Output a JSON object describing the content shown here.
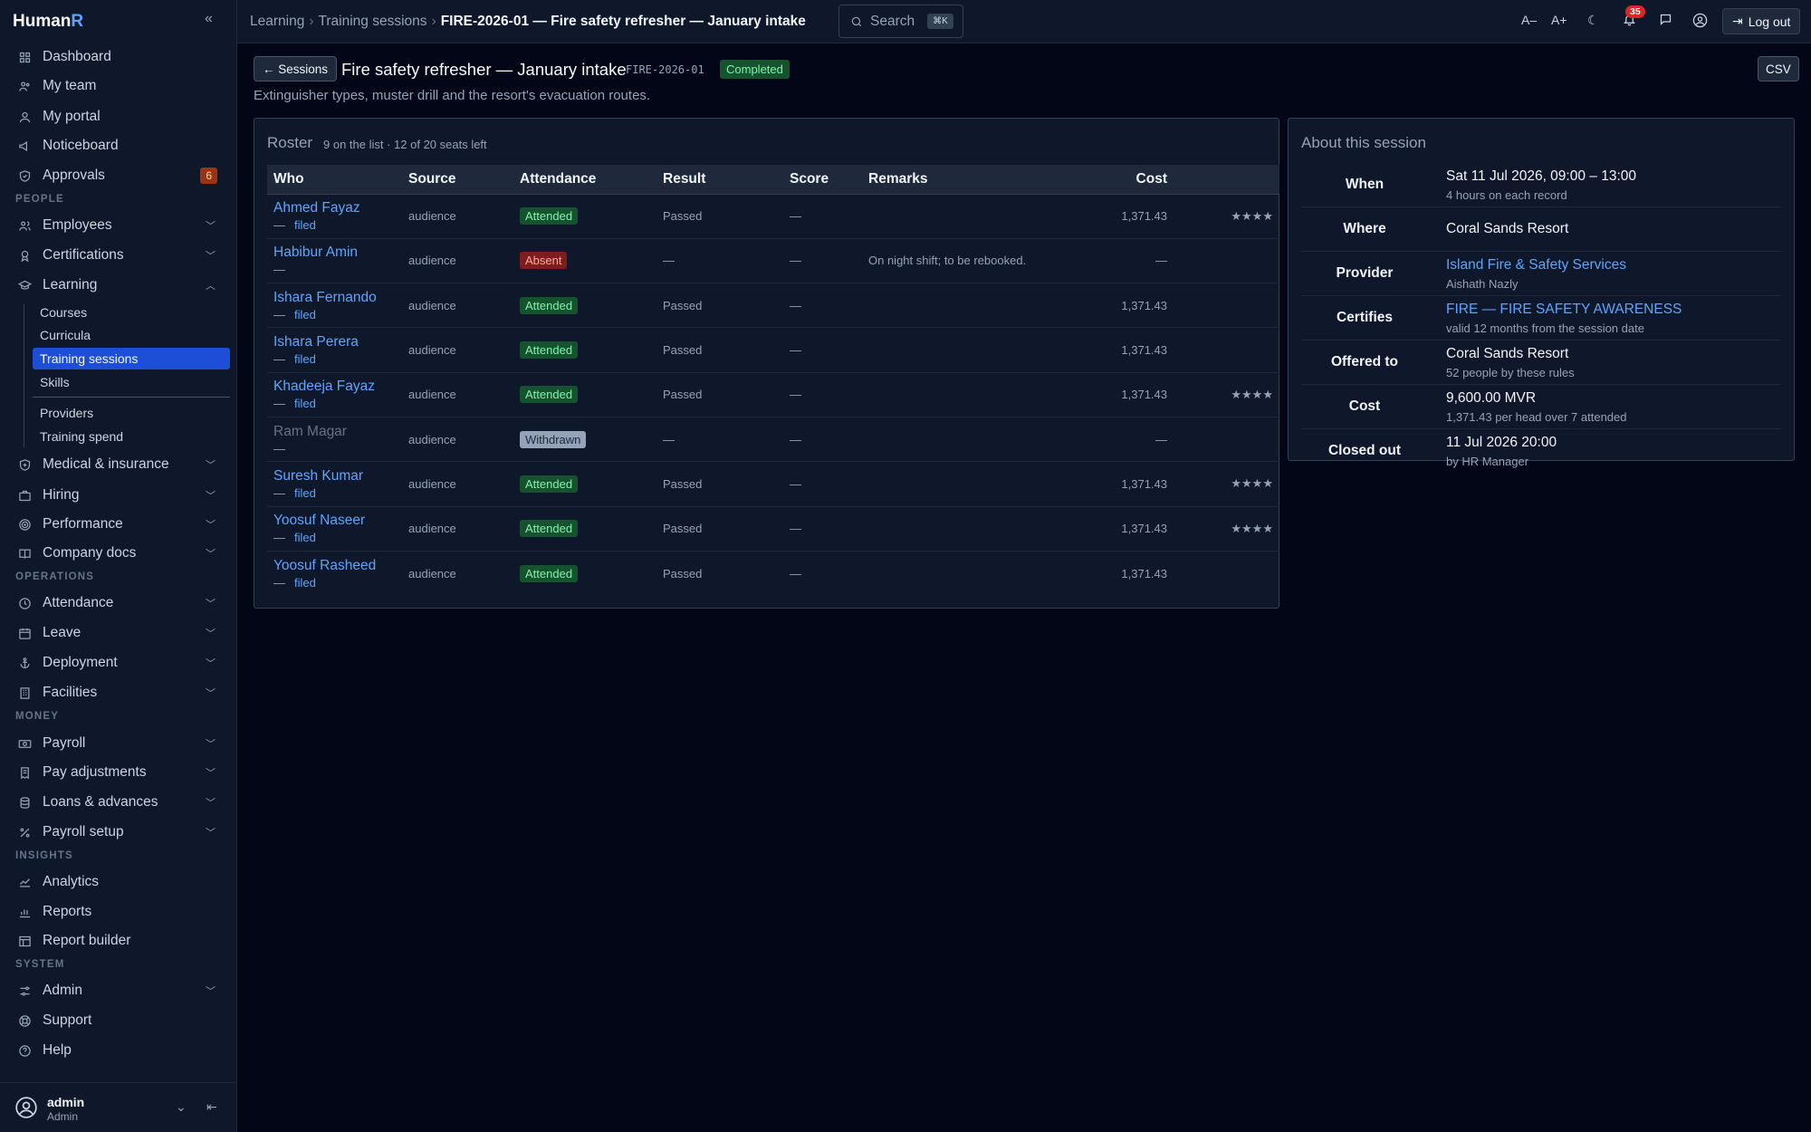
{
  "brand": {
    "name_a": "Human",
    "name_b": "R"
  },
  "sidebar": {
    "top_items": [
      {
        "label": "Dashboard",
        "icon": "grid-icon"
      },
      {
        "label": "My team",
        "icon": "team-icon"
      },
      {
        "label": "My portal",
        "icon": "person-icon"
      },
      {
        "label": "Noticeboard",
        "icon": "megaphone-icon"
      },
      {
        "label": "Approvals",
        "icon": "shield-check-icon",
        "badge": "6"
      }
    ],
    "sections": {
      "people": "PEOPLE",
      "operations": "OPERATIONS",
      "money": "MONEY",
      "insights": "INSIGHTS",
      "system": "SYSTEM"
    },
    "people_items": [
      {
        "label": "Employees"
      },
      {
        "label": "Certifications"
      },
      {
        "label": "Learning"
      }
    ],
    "learning_sub": [
      "Courses",
      "Curricula",
      "Training sessions",
      "Skills",
      "Providers",
      "Training spend"
    ],
    "people_items2": [
      {
        "label": "Medical & insurance"
      },
      {
        "label": "Hiring"
      },
      {
        "label": "Performance"
      },
      {
        "label": "Company docs"
      }
    ],
    "operations_items": [
      {
        "label": "Attendance"
      },
      {
        "label": "Leave"
      },
      {
        "label": "Deployment"
      },
      {
        "label": "Facilities"
      }
    ],
    "money_items": [
      {
        "label": "Payroll"
      },
      {
        "label": "Pay adjustments"
      },
      {
        "label": "Loans & advances"
      },
      {
        "label": "Payroll setup"
      }
    ],
    "insights_items": [
      {
        "label": "Analytics"
      },
      {
        "label": "Reports"
      },
      {
        "label": "Report builder"
      }
    ],
    "system_items": [
      {
        "label": "Admin"
      },
      {
        "label": "Support"
      },
      {
        "label": "Help"
      }
    ],
    "user": {
      "name": "admin",
      "role": "Admin"
    }
  },
  "topbar": {
    "crumbs": [
      "Learning",
      "Training sessions",
      "FIRE-2026-01 — Fire safety refresher — January intake"
    ],
    "search_label": "Search",
    "search_kbd": "⌘K",
    "font_smaller": "A–",
    "font_larger": "A+",
    "notif_count": "35",
    "logout_label": "Log out"
  },
  "header": {
    "back_label": "← Sessions",
    "title": "Fire safety refresher — January intake",
    "code": "FIRE-2026-01",
    "status": "Completed",
    "csv_label": "CSV",
    "subtitle": "Extinguisher types, muster drill and the resort's evacuation routes."
  },
  "roster": {
    "title": "Roster",
    "meta": "9 on the list · 12 of 20 seats left",
    "columns": [
      "Who",
      "Source",
      "Attendance",
      "Result",
      "Score",
      "Remarks",
      "Cost"
    ],
    "rows": [
      {
        "name": "Ahmed Fayaz",
        "sub_dash": "—",
        "sub_filed": "filed",
        "source": "audience",
        "attendance": "Attended",
        "att_class": "attended",
        "result": "Passed",
        "score": "—",
        "remarks": "",
        "cost": "1,371.43",
        "rating": "★★★★"
      },
      {
        "name": "Habibur Amin",
        "sub_dash": "—",
        "sub_filed": "",
        "source": "audience",
        "attendance": "Absent",
        "att_class": "absent",
        "result": "—",
        "score": "—",
        "remarks": "On night shift; to be rebooked.",
        "cost": "—",
        "rating": ""
      },
      {
        "name": "Ishara Fernando",
        "sub_dash": "—",
        "sub_filed": "filed",
        "source": "audience",
        "attendance": "Attended",
        "att_class": "attended",
        "result": "Passed",
        "score": "—",
        "remarks": "",
        "cost": "1,371.43",
        "rating": ""
      },
      {
        "name": "Ishara Perera",
        "sub_dash": "—",
        "sub_filed": "filed",
        "source": "audience",
        "attendance": "Attended",
        "att_class": "attended",
        "result": "Passed",
        "score": "—",
        "remarks": "",
        "cost": "1,371.43",
        "rating": ""
      },
      {
        "name": "Khadeeja Fayaz",
        "sub_dash": "—",
        "sub_filed": "filed",
        "source": "audience",
        "attendance": "Attended",
        "att_class": "attended",
        "result": "Passed",
        "score": "—",
        "remarks": "",
        "cost": "1,371.43",
        "rating": "★★★★"
      },
      {
        "name": "Ram Magar",
        "sub_dash": "—",
        "sub_filed": "",
        "source": "audience",
        "attendance": "Withdrawn",
        "att_class": "withdrawn",
        "result": "—",
        "score": "—",
        "remarks": "",
        "cost": "—",
        "rating": "",
        "withdrawn": true
      },
      {
        "name": "Suresh Kumar",
        "sub_dash": "—",
        "sub_filed": "filed",
        "source": "audience",
        "attendance": "Attended",
        "att_class": "attended",
        "result": "Passed",
        "score": "—",
        "remarks": "",
        "cost": "1,371.43",
        "rating": "★★★★"
      },
      {
        "name": "Yoosuf Naseer",
        "sub_dash": "—",
        "sub_filed": "filed",
        "source": "audience",
        "attendance": "Attended",
        "att_class": "attended",
        "result": "Passed",
        "score": "—",
        "remarks": "",
        "cost": "1,371.43",
        "rating": "★★★★"
      },
      {
        "name": "Yoosuf Rasheed",
        "sub_dash": "—",
        "sub_filed": "filed",
        "source": "audience",
        "attendance": "Attended",
        "att_class": "attended",
        "result": "Passed",
        "score": "—",
        "remarks": "",
        "cost": "1,371.43",
        "rating": ""
      }
    ]
  },
  "about": {
    "title": "About this session",
    "rows": [
      {
        "label": "When",
        "value": "Sat 11 Jul 2026, 09:00 – 13:00",
        "sub": "4 hours on each record",
        "link": false
      },
      {
        "label": "Where",
        "value": "Coral Sands Resort",
        "sub": "",
        "link": false
      },
      {
        "label": "Provider",
        "value": "Island Fire & Safety Services",
        "sub": "Aishath Nazly",
        "link": true
      },
      {
        "label": "Certifies",
        "value": "FIRE — FIRE SAFETY AWARENESS",
        "sub": "valid 12 months from the session date",
        "link": true
      },
      {
        "label": "Offered to",
        "value": "Coral Sands Resort",
        "sub": "52 people by these rules",
        "link": false
      },
      {
        "label": "Cost",
        "value": "9,600.00 MVR",
        "sub": "1,371.43 per head over 7 attended",
        "link": false
      },
      {
        "label": "Closed out",
        "value": "11 Jul 2026 20:00",
        "sub": "by HR Manager",
        "link": false
      }
    ]
  }
}
